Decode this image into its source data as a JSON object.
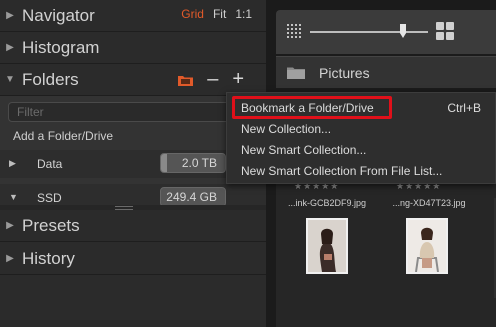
{
  "left_panel": {
    "navigator": {
      "title": "Navigator",
      "links": {
        "grid": "Grid",
        "fit": "Fit",
        "ratio": "1:1"
      }
    },
    "histogram": {
      "title": "Histogram"
    },
    "folders": {
      "title": "Folders",
      "filter_placeholder": "Filter",
      "add_folder": "Add a Folder/Drive",
      "volumes": [
        {
          "name": "Data",
          "size": "2.0 TB",
          "used_fraction": 0.1
        },
        {
          "name": "SSD",
          "size": "249.4 GB"
        }
      ]
    },
    "presets": {
      "title": "Presets"
    },
    "history": {
      "title": "History"
    }
  },
  "browser": {
    "path_label": "Pictures",
    "thumbnails": [
      {
        "filename": "...ink-GCB2DF9.jpg"
      },
      {
        "filename": "...ng-XD47T23.jpg"
      }
    ],
    "stars": "★★★★★"
  },
  "context_menu": {
    "items": [
      {
        "label": "Bookmark a Folder/Drive",
        "shortcut": "Ctrl+B"
      },
      {
        "label": "New Collection..."
      },
      {
        "label": "New Smart Collection..."
      },
      {
        "label": "New Smart Collection From File List..."
      }
    ]
  },
  "colors": {
    "accent": "#e15a2a",
    "highlight_outline": "#e0101a"
  },
  "icons": [
    "expand-triangle-icon",
    "collapse-triangle-icon",
    "orange-folder-icon",
    "minus-icon",
    "plus-icon",
    "small-grid-icon",
    "large-grid-icon",
    "folder-icon"
  ]
}
